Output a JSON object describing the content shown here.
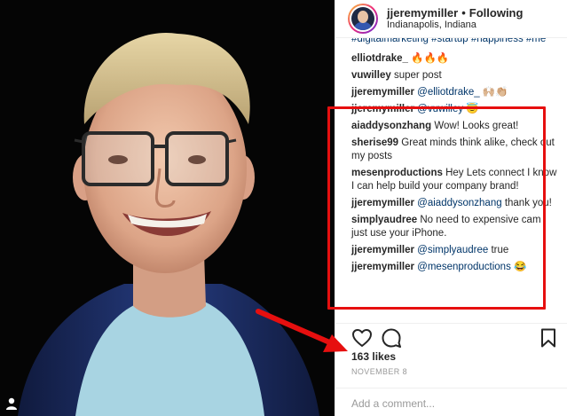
{
  "post": {
    "username": "jjeremymiller",
    "separator": "•",
    "follow_status": "Following",
    "location": "Indianapolis, Indiana"
  },
  "caption_tail": "#digitalmarketing #startup #happiness #me",
  "comments": [
    {
      "user": "elliotdrake_",
      "text": "🔥🔥🔥"
    },
    {
      "user": "vuwilley",
      "text": "super post"
    },
    {
      "user": "jjeremymiller",
      "mention": "@elliotdrake_",
      "text": "🙌🏼👏🏼"
    },
    {
      "user": "jjeremymiller",
      "mention": "@vuwilley",
      "text": "😇"
    },
    {
      "user": "aiaddysonzhang",
      "text": "Wow! Looks great!"
    },
    {
      "user": "sherise99",
      "text": "Great minds think alike, check out my posts"
    },
    {
      "user": "mesenproductions",
      "text": "Hey Lets connect I know I can help build your company brand!"
    },
    {
      "user": "jjeremymiller",
      "mention": "@aiaddysonzhang",
      "text": "thank you!"
    },
    {
      "user": "simplyaudree",
      "text": "No need to expensive cam just use your iPhone."
    },
    {
      "user": "jjeremymiller",
      "mention": "@simplyaudree",
      "text": "true"
    },
    {
      "user": "jjeremymiller",
      "mention": "@mesenproductions",
      "text": "😂"
    }
  ],
  "likes": "163 likes",
  "date": "NOVEMBER 8",
  "add_comment_placeholder": "Add a comment...",
  "icons": {
    "like": "heart-icon",
    "comment": "comment-bubble-icon",
    "save": "bookmark-icon",
    "user_tag": "person-icon"
  },
  "colors": {
    "highlight": "#e60f0f",
    "mention": "#003569"
  }
}
